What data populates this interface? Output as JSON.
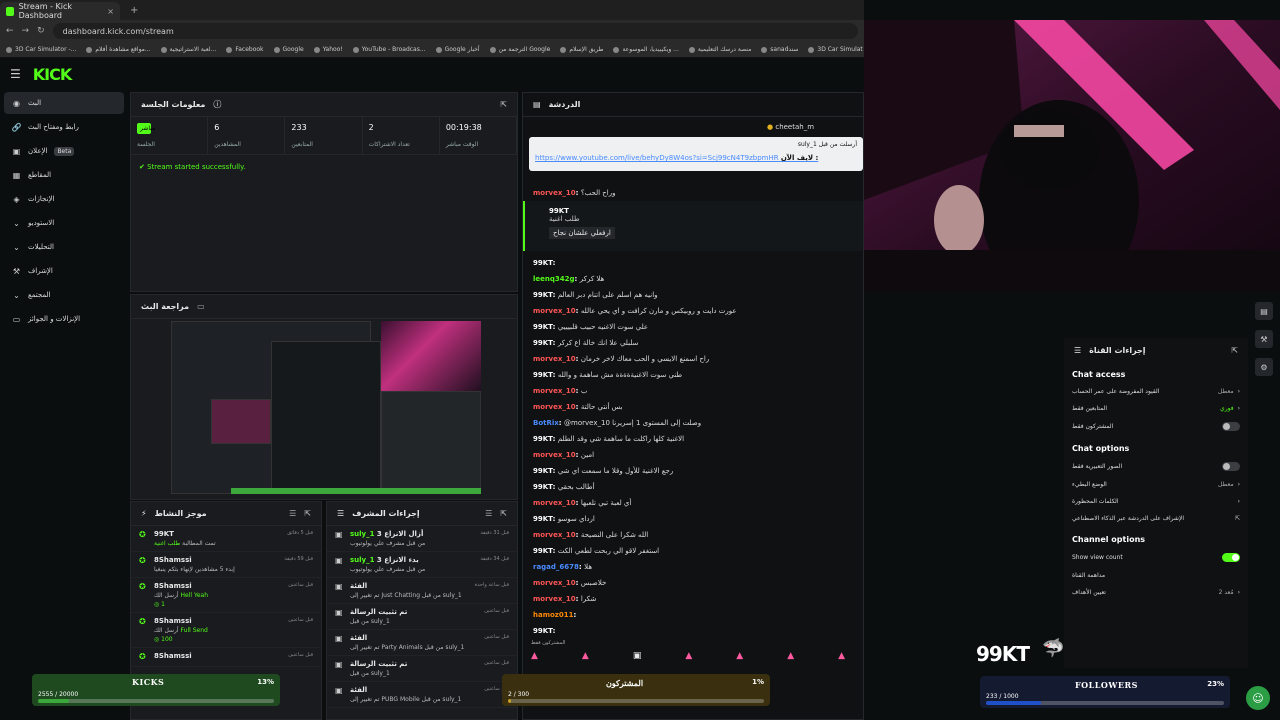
{
  "browser": {
    "tab_title": "Stream - Kick Dashboard",
    "url": "dashboard.kick.com/stream",
    "bookmarks": [
      "3D Car Simulator -...",
      "مواقع مشاهدة أفلام...",
      "لعبة الاستراتيجية...",
      "Facebook",
      "Google",
      "Yahoo!",
      "YouTube - Broadcas...",
      "Google أخبار",
      "الترجمة من Google",
      "طريق الإسلام",
      "ويكيبيديا، الموسوعة ...",
      "منصة درسك التعليمية",
      "sanadسند",
      "3D Car Simulat"
    ]
  },
  "logo": "KICK",
  "sidebar": {
    "items": [
      {
        "label": "البث",
        "icon": "broadcast-icon",
        "active": true
      },
      {
        "label": "رابط ومفتاح البث",
        "icon": "key-icon"
      },
      {
        "label": "الإعلان",
        "icon": "ad-icon",
        "badge": "Beta"
      },
      {
        "label": "المقاطع",
        "icon": "clip-icon"
      },
      {
        "label": "الإنجازات",
        "icon": "achievement-icon"
      },
      {
        "label": "الاستوديو",
        "icon": "studio-icon"
      },
      {
        "label": "التحليلات",
        "icon": "analytics-icon"
      },
      {
        "label": "الإشراف",
        "icon": "moderation-icon"
      },
      {
        "label": "المجتمع",
        "icon": "community-icon"
      },
      {
        "label": "الإنزالات و الجوائز",
        "icon": "drops-icon"
      }
    ]
  },
  "session": {
    "title": "معلومات الجلسة",
    "live_label": "مباشر",
    "stats": [
      {
        "value": "",
        "label": "الجلسة"
      },
      {
        "value": "6",
        "label": "المشاهدين"
      },
      {
        "value": "233",
        "label": "المتابعين"
      },
      {
        "value": "2",
        "label": "تعداد الاشتراكات"
      },
      {
        "value": "00:19:38",
        "label": "الوقت مباشر"
      }
    ],
    "status": "Stream started successfully."
  },
  "preview": {
    "title": "مراجعة البث"
  },
  "activity": {
    "title": "موجز النشاط",
    "items": [
      {
        "name": "99KT",
        "sub": "تمت المطالبة",
        "action": "طلب اغنية",
        "time": "قبل 5 دقائق"
      },
      {
        "name": "8Shamssi",
        "sub": "إبدء 5 مشاهدين لإنهاء بثكم ينبغيا",
        "time": "قبل 59 دقيقة"
      },
      {
        "name": "8Shamssi",
        "sub": "أرسل الك",
        "action": "Hell Yeah",
        "count": "1",
        "time": "قبل ساعتين"
      },
      {
        "name": "8Shamssi",
        "sub": "أرسل الك",
        "action": "Full Send",
        "count": "100",
        "time": "قبل ساعتين"
      },
      {
        "name": "8Shamssi",
        "sub": "",
        "time": "قبل ساعتين"
      }
    ]
  },
  "modactions": {
    "title": "إجراءات المشرف",
    "items": [
      {
        "name": "suly_1",
        "action": "أزال الانزاع 3",
        "sub": "من قبل مشرف علي يولوتيوب",
        "time": "قبل 31 دقيقة"
      },
      {
        "name": "suly_1",
        "action": "بدء الانزاع 3",
        "sub": "من قبل مشرف علي يولوتيوب",
        "time": "قبل 34 دقيقة"
      },
      {
        "name": "الفئة",
        "action": "",
        "sub": "تم تغيير إلى Just Chatting من قبل suly_1",
        "time": "قبل ساعة واحدة"
      },
      {
        "name": "تم تثبيت الرسالة",
        "action": "",
        "sub": "من قبل suly_1",
        "time": "قبل ساعتين"
      },
      {
        "name": "الفئة",
        "action": "",
        "sub": "تم تغيير إلى Party Animals من قبل suly_1",
        "time": "قبل ساعتين"
      },
      {
        "name": "تم تثبيت الرسالة",
        "action": "",
        "sub": "من قبل suly_1",
        "time": "قبل ساعتين"
      },
      {
        "name": "الفئة",
        "action": "",
        "sub": "تم تغيير إلى PUBG Mobile من قبل suly_1",
        "time": "قبل ساعتين"
      }
    ]
  },
  "chat": {
    "title": "الدردشة",
    "host": "cheetah_m",
    "pinned_by": "suly_1 أرسلت من قبل",
    "pinned_label": "لايف الآن :",
    "pinned_url": "https://www.youtube.com/live/behyDy8W4os?si=Scj99cN4T9zbpmHR",
    "redeem_user": "99KT",
    "redeem_text": "طلب اغنية",
    "redeem_note": "ارفعلي علشان نجاح",
    "messages": [
      {
        "user": "morvex_10",
        "text": "وراح الحب؟",
        "c": "n2"
      },
      {
        "user": "99KT",
        "text": "",
        "c": "n1"
      },
      {
        "user": "leenq342g",
        "text": "هلا كركر",
        "c": "n3"
      },
      {
        "user": "99KT",
        "text": "وانيه هم اسلم على اتنام دبر العالم",
        "c": "n1"
      },
      {
        "user": "morvex_10",
        "text": "عورت دايت و روبيكس و مارن كرافت و اي يحي عالله",
        "c": "n2"
      },
      {
        "user": "99KT",
        "text": "علي سوت الاغنيه حبيب قلبيييي",
        "c": "n1"
      },
      {
        "user": "99KT",
        "text": "سلبلي علا انك خالة اع كركر",
        "c": "n1"
      },
      {
        "user": "morvex_10",
        "text": "راح اسمنع الايسي و الحب معاك لاخر خرمان",
        "c": "n2"
      },
      {
        "user": "99KT",
        "text": "طني سوت الاغنيةةةةة مش ساهمة و والله",
        "c": "n1"
      },
      {
        "user": "morvex_10",
        "text": "ب",
        "c": "n2"
      },
      {
        "user": "morvex_10",
        "text": "بس أنتي حالتة",
        "c": "n2"
      },
      {
        "user": "BotRix",
        "text": "@morvex_10 وصلت إلى المستوى 1 إسريرنا",
        "c": "n4"
      },
      {
        "user": "99KT",
        "text": "الاغنية كلها راكلت ما ساهمة شي وقد الطلم",
        "c": "n1"
      },
      {
        "user": "morvex_10",
        "text": "امين",
        "c": "n2"
      },
      {
        "user": "99KT",
        "text": "رجع الاغنية للأول وقلا ما سمعت اي شي",
        "c": "n1"
      },
      {
        "user": "99KT",
        "text": "أطالب بحقي",
        "c": "n1"
      },
      {
        "user": "morvex_10",
        "text": "أي لعبة تبي تلعبها",
        "c": "n2"
      },
      {
        "user": "99KT",
        "text": "ارداي سوسو",
        "c": "n1"
      },
      {
        "user": "morvex_10",
        "text": "الله شكرا على النصيحة",
        "c": "n2"
      },
      {
        "user": "99KT",
        "text": "استغفر لاقو الي ربحت لطعي الكت",
        "c": "n1"
      },
      {
        "user": "ragad_6678",
        "text": "هلا",
        "c": "n4"
      },
      {
        "user": "morvex_10",
        "text": "خلاصبس",
        "c": "n2"
      },
      {
        "user": "morvex_10",
        "text": "شكرا",
        "c": "n2"
      },
      {
        "user": "hamoz011",
        "text": "",
        "c": "n5"
      },
      {
        "user": "99KT",
        "text": "",
        "c": "n1"
      }
    ],
    "bottom_label": "المشتركون فقط"
  },
  "channel_settings": {
    "title": "إجراءات القناة",
    "chat_access": "Chat access",
    "rows_access": [
      {
        "label": "القيود المفروضة على عمر الحساب",
        "value": "معطل",
        "type": "chevron"
      },
      {
        "label": "المتابعين فقط",
        "value": "فوري",
        "type": "chevron"
      },
      {
        "label": "المشتركون فقط",
        "value": "",
        "type": "toggle",
        "on": false
      }
    ],
    "chat_options": "Chat options",
    "rows_options": [
      {
        "label": "الصور التعبيرية فقط",
        "value": "",
        "type": "toggle",
        "on": false
      },
      {
        "label": "الوضع البطيء",
        "value": "معطل",
        "type": "chevron"
      },
      {
        "label": "الكلمات المحظورة",
        "value": "",
        "type": "chevron"
      },
      {
        "label": "الإشراف على الدردشة عبر الذكاء الاصطناعي",
        "value": "",
        "type": "external"
      }
    ],
    "channel_options": "Channel options",
    "rows_channel": [
      {
        "label": "Show view count",
        "value": "",
        "type": "toggle",
        "on": true
      },
      {
        "label": "مداهمة القناة",
        "value": "",
        "type": "none"
      },
      {
        "label": "تعيين الأهداف",
        "value": "مُعد 2",
        "type": "chevron"
      }
    ]
  },
  "overlay": {
    "name": "99KT"
  },
  "goals": [
    {
      "title": "KICKS",
      "count": "2555 / 20000",
      "percent": "13%",
      "fraction": 0.13,
      "color": "#3ca83c"
    },
    {
      "title": "المشتركون",
      "count": "2 / 300",
      "percent": "1%",
      "fraction": 0.01,
      "color": "#c8a020"
    },
    {
      "title": "FOLLOWERS",
      "count": "233 / 1000",
      "percent": "23%",
      "fraction": 0.23,
      "color": "#2050c8"
    }
  ],
  "colors": {
    "accent": "#53fc18",
    "panel": "#191b1f",
    "bg": "#0b0e0f"
  }
}
